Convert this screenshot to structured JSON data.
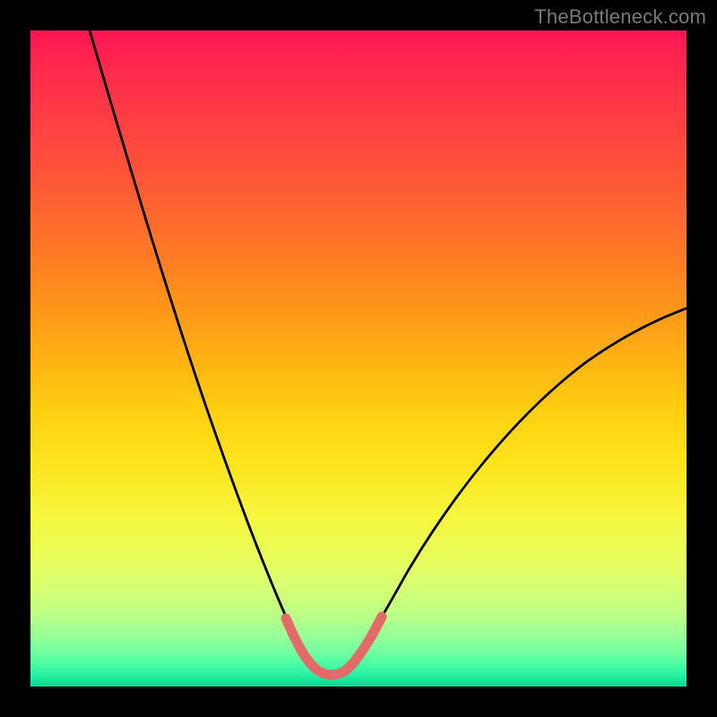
{
  "watermark": "TheBottleneck.com",
  "colors": {
    "page_bg": "#000000",
    "gradient_top": "#ff1552",
    "gradient_mid": "#ffe822",
    "gradient_bottom": "#0cd890",
    "curve_stroke": "#000000",
    "highlight_stroke": "#e46a6a"
  },
  "chart_data": {
    "type": "line",
    "title": "",
    "xlabel": "",
    "ylabel": "",
    "xlim": [
      0,
      100
    ],
    "ylim": [
      0,
      100
    ],
    "grid": false,
    "legend": false,
    "annotations": [],
    "series": [
      {
        "name": "left-curve",
        "x": [
          9,
          12,
          15,
          18,
          21,
          24,
          27,
          30,
          33,
          36,
          38,
          40,
          42
        ],
        "y": [
          100,
          87,
          74,
          62,
          51,
          41,
          32,
          24,
          17,
          11,
          8,
          6,
          4
        ]
      },
      {
        "name": "right-curve",
        "x": [
          48,
          50,
          53,
          56,
          60,
          65,
          70,
          76,
          82,
          88,
          94,
          100
        ],
        "y": [
          4,
          6,
          9,
          13,
          18,
          24,
          30,
          36,
          42,
          48,
          53,
          58
        ]
      },
      {
        "name": "valley-floor",
        "x": [
          42,
          44,
          46,
          48
        ],
        "y": [
          4,
          3,
          3,
          4
        ]
      },
      {
        "name": "valley-highlight",
        "x": [
          38,
          40,
          42,
          44,
          46,
          48,
          50,
          52
        ],
        "y": [
          9,
          6,
          4,
          3,
          3,
          4,
          6,
          9
        ]
      }
    ]
  }
}
